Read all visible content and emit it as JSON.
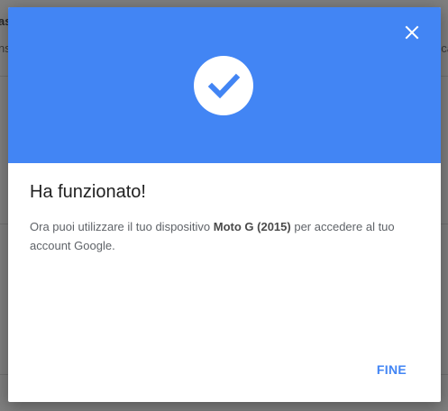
{
  "background": {
    "text_left_1": "as",
    "text_left_2": "ns",
    "text_right_1": "ca"
  },
  "dialog": {
    "header_color": "#4285f4",
    "close_icon": "close-icon",
    "status_icon": "check-circle-icon",
    "title": "Ha funzionato!",
    "body_prefix": "Ora puoi utilizzare il tuo dispositivo ",
    "device_name": "Moto G (2015)",
    "body_suffix": " per accedere al tuo account Google.",
    "done_label": "FINE"
  }
}
